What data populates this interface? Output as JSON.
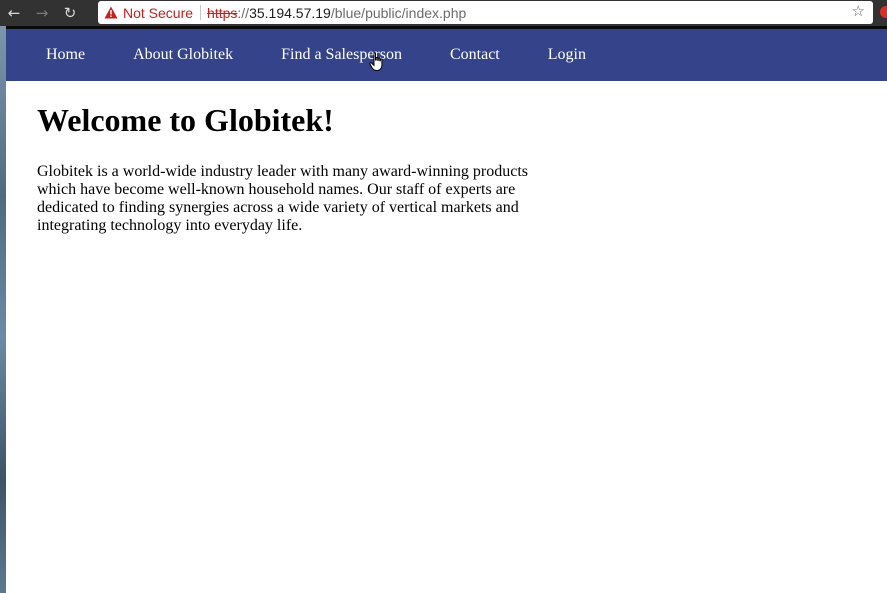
{
  "browser": {
    "back_icon": "arrow-left-icon",
    "forward_icon": "arrow-right-icon",
    "reload_icon": "reload-icon",
    "security_label": "Not Secure",
    "url_scheme": "https",
    "url_separator": "://",
    "url_host": "35.194.57.19",
    "url_path": "/blue/public/index.php",
    "bookmark_icon": "star-icon"
  },
  "nav": {
    "items": [
      {
        "label": "Home"
      },
      {
        "label": "About Globitek"
      },
      {
        "label": "Find a Salesperson"
      },
      {
        "label": "Contact"
      },
      {
        "label": "Login"
      }
    ],
    "background": "#34438a"
  },
  "main": {
    "heading": "Welcome to Globitek!",
    "intro": "Globitek is a world-wide industry leader with many award-winning products which have become well-known household names. Our staff of experts are dedicated to finding synergies across a wide variety of vertical markets and integrating technology into everyday life."
  },
  "colors": {
    "not_secure": "#c5221f"
  }
}
